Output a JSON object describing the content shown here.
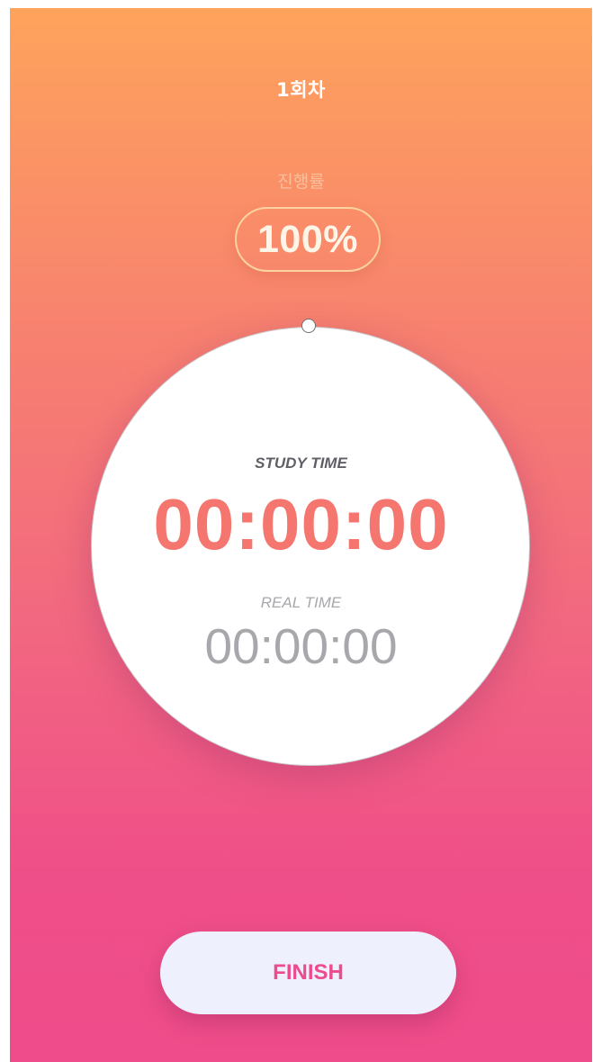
{
  "session": {
    "title": "1회차"
  },
  "progress": {
    "label": "진행률",
    "value": "100%",
    "fraction": 1.0
  },
  "timer": {
    "study_label": "STUDY TIME",
    "study_time": "00:00:00",
    "real_label": "REAL TIME",
    "real_time": "00:00:00"
  },
  "actions": {
    "finish_label": "FINISH"
  },
  "colors": {
    "gradient_top": "#fea35c",
    "gradient_bottom": "#ee4c8a",
    "study_time_color": "#f5756f",
    "real_time_color": "#a8a8ac",
    "finish_text_color": "#ec4b8c",
    "finish_button_bg": "#eef0fd"
  }
}
